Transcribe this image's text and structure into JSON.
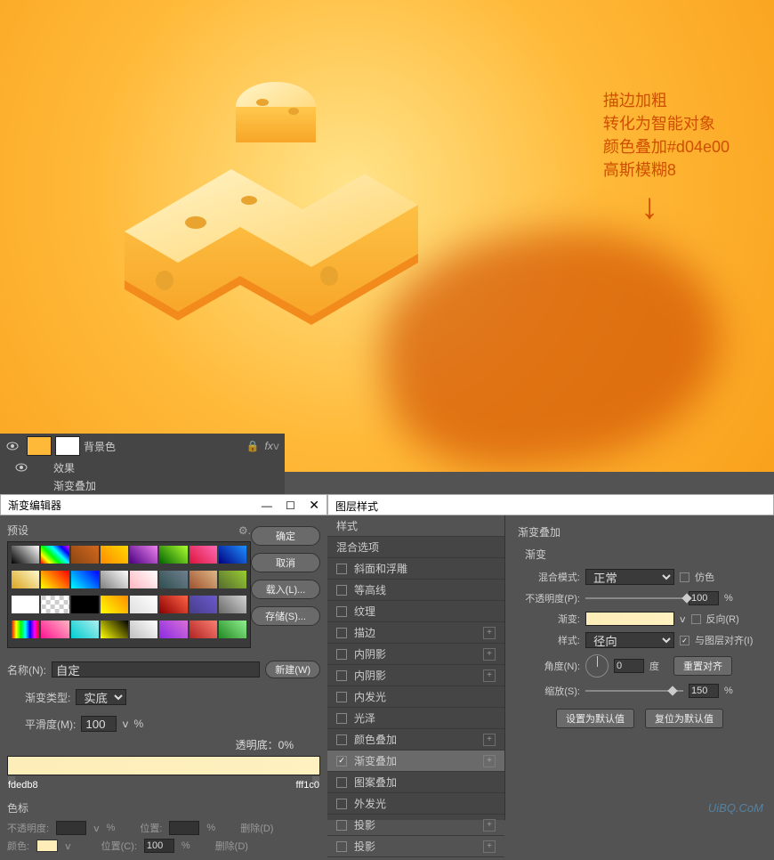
{
  "annotation": {
    "line1": "描边加粗",
    "line2": "转化为智能对象",
    "line3": "颜色叠加#d04e00",
    "line4": "高斯模糊8",
    "arrow": "↓"
  },
  "layers_panel": {
    "layer_name": "背景色",
    "effects_label": "效果",
    "gradient_overlay_label": "渐变叠加",
    "fx": "fx"
  },
  "gradient_editor": {
    "title": "渐变编辑器",
    "presets_label": "预设",
    "ok": "确定",
    "cancel": "取消",
    "load": "载入(L)...",
    "save": "存储(S)...",
    "name_label": "名称(N):",
    "name_value": "自定",
    "new_btn": "新建(W)",
    "type_label": "渐变类型:",
    "type_value": "实底",
    "smoothness_label": "平滑度(M):",
    "smoothness_value": "100",
    "smoothness_unit": "%",
    "opacity_label": "透明底：0%",
    "stop_left": "fdedb8",
    "stop_right": "fff1c0",
    "stops_title": "色标",
    "opacity_stop_label": "不透明度:",
    "position_label": "位置:",
    "delete_label": "删除(D)",
    "color_label": "颜色:",
    "position_c_label": "位置(C):",
    "position_value": "100",
    "pct": "%"
  },
  "layer_style": {
    "title": "图层样式",
    "list": {
      "styles": "样式",
      "blend_options": "混合选项",
      "bevel": "斜面和浮雕",
      "contour": "等高线",
      "texture": "纹理",
      "stroke": "描边",
      "inner_shadow": "内阴影",
      "inner_shadow2": "内阴影",
      "inner_glow": "内发光",
      "satin": "光泽",
      "color_overlay": "颜色叠加",
      "gradient_overlay": "渐变叠加",
      "pattern_overlay": "图案叠加",
      "outer_glow": "外发光",
      "drop_shadow": "投影",
      "drop_shadow2": "投影"
    },
    "settings": {
      "group_title": "渐变叠加",
      "sub_title": "渐变",
      "blend_mode_label": "混合模式:",
      "blend_mode_value": "正常",
      "dither_label": "仿色",
      "opacity_label": "不透明度(P):",
      "opacity_value": "100",
      "gradient_label": "渐变:",
      "reverse_label": "反向(R)",
      "style_label": "样式:",
      "style_value": "径向",
      "align_label": "与图层对齐(I)",
      "angle_label": "角度(N):",
      "angle_value": "0",
      "angle_unit": "度",
      "reset_align": "重置对齐",
      "scale_label": "缩放(S):",
      "scale_value": "150",
      "pct": "%",
      "make_default": "设置为默认值",
      "reset_default": "复位为默认值"
    }
  },
  "watermark": "UiBQ.CoM"
}
